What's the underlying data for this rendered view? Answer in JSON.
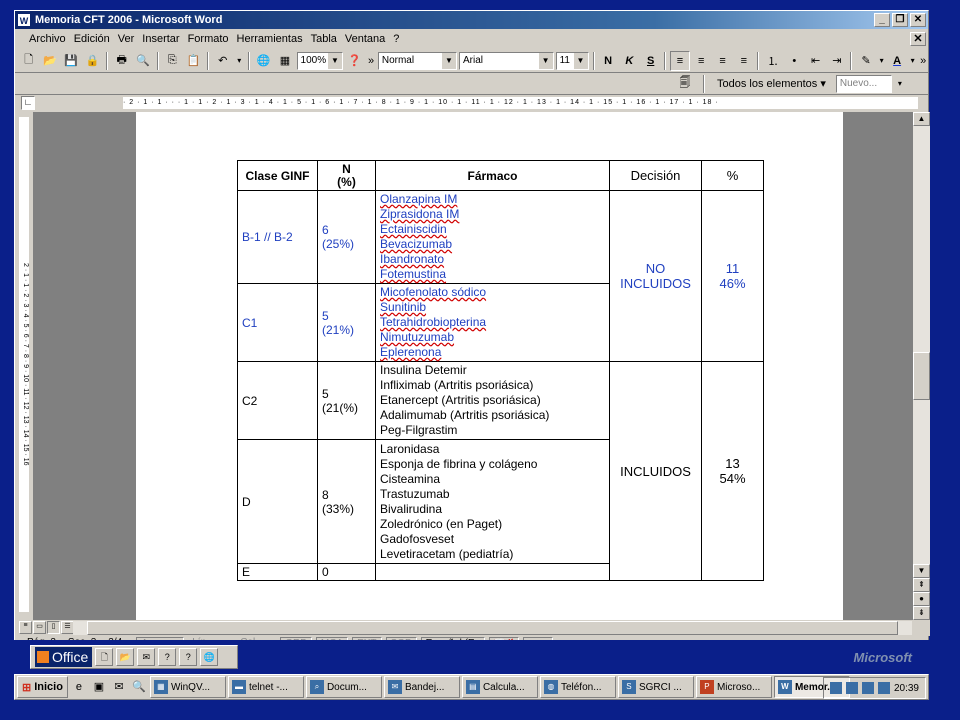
{
  "window": {
    "title": "Memoria CFT 2006 - Microsoft Word"
  },
  "menu": [
    "Archivo",
    "Edición",
    "Ver",
    "Insertar",
    "Formato",
    "Herramientas",
    "Tabla",
    "Ventana",
    "?"
  ],
  "toolbar": {
    "zoom": "100%",
    "style": "Normal",
    "font": "Arial",
    "size": "11",
    "bold": "N",
    "italic": "K",
    "underline": "S"
  },
  "toolbar2": {
    "elements": "Todos los elementos",
    "new": "Nuevo..."
  },
  "ruler": {
    "h": "· 2 · 1 · 1 · · · 1 · 1 · 2 · 1 · 3 · 1 · 4 · 1 · 5 · 1 · 6 · 1 · 7 · 1 · 8 · 1 · 9 · 1 · 10 · 1 · 11 · 1 · 12 · 1 · 13 · 1 · 14 · 1 · 15 · 1 · 16 · 1 · 17 · 1 · 18 ·",
    "v": "2 · 1 · 1 · 2 · 3 · 4 · 5 · 6 · 7 · 8 · 9 · 10 · 11 · 12 · 13 · 14 · 15 · 16"
  },
  "table": {
    "headers": [
      "Clase GINF",
      "N\n(%)",
      "Fármaco",
      "Decisión",
      "%"
    ],
    "rows": [
      {
        "clase": "B-1 // B-2",
        "n": "6",
        "pct": "(25%)",
        "drugs": [
          "Olanzapina IM",
          "Ziprasidona IM",
          "Ectainiscidin",
          "Bevacizumab",
          "Ibandronato",
          "Fotemustina"
        ]
      },
      {
        "clase": "C1",
        "n": "5",
        "pct": "(21%)",
        "drugs": [
          "Micofenolato sódico",
          "Sunitinib",
          "Tetrahidrobiopterina",
          "Nimutuzumab",
          "Eplerenona"
        ]
      },
      {
        "clase": "C2",
        "n": "5",
        "pct": "(21(%)",
        "drugs": [
          "Insulina Detemir",
          "Infliximab (Artritis psoriásica)",
          "Etanercept (Artritis psoriásica)",
          "Adalimumab (Artritis psoriásica)",
          "Peg-Filgrastim"
        ]
      },
      {
        "clase": "D",
        "n": "8",
        "pct": "(33%)",
        "drugs": [
          "Laronidasa",
          "Esponja de fibrina y colágeno",
          "Cisteamina",
          "Trastuzumab",
          "Bivalirudina",
          "Zoledrónico (en Paget)",
          "Gadofosveset",
          "Levetiracetam (pediatría)"
        ]
      },
      {
        "clase": "E",
        "n": "0",
        "pct": "",
        "drugs": []
      }
    ],
    "decision": [
      {
        "label1": "NO",
        "label2": "INCLUIDOS",
        "n": "11",
        "pct": "46%"
      },
      {
        "label1": "INCLUIDOS",
        "label2": "",
        "n": "13",
        "pct": "54%"
      }
    ]
  },
  "statusbar": {
    "page": "Pág. 3",
    "section": "Sec. 3",
    "pages": "3/4",
    "at": "A",
    "line": "Lín.",
    "col": "Col.",
    "modes": [
      "GRB",
      "MCA",
      "EXT",
      "SOB"
    ],
    "language": "Español (Es"
  },
  "officebar": {
    "label": "Office",
    "brand": "Microsoft"
  },
  "taskbar": {
    "start": "Inicio",
    "tasks": [
      "WinQV...",
      "telnet -...",
      "Docum...",
      "Bandej...",
      "Calcula...",
      "Teléfon...",
      "SGRCI ...",
      "Microso...",
      "Memor..."
    ],
    "clock": "20:39"
  }
}
